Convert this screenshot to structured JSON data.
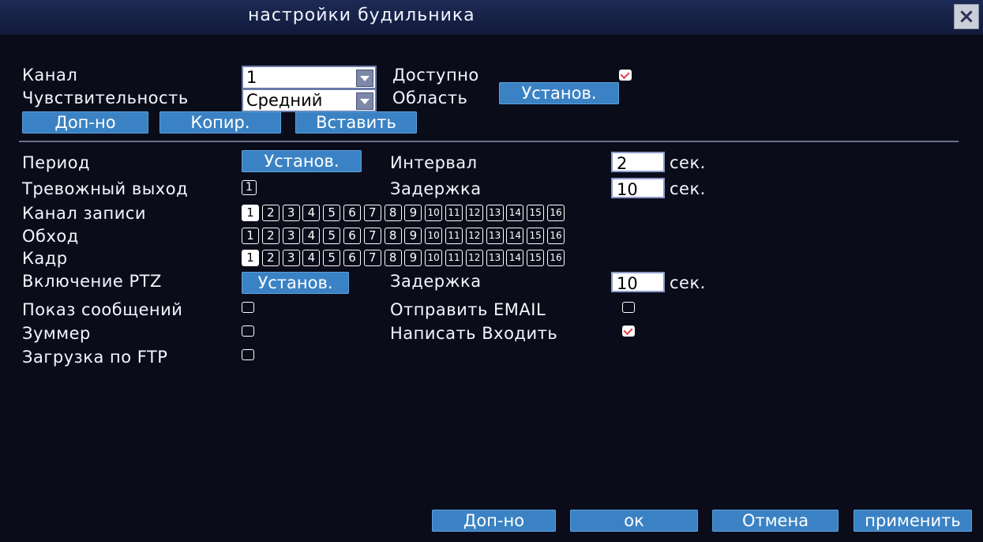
{
  "title": "настройки будильника",
  "close": "×",
  "top": {
    "channel_label": "Канал",
    "channel_value": "1",
    "enabled_label": "Доступно",
    "enabled_checked": true,
    "sensitivity_label": "Чувствительность",
    "sensitivity_value": "Средний",
    "area_label": "Область",
    "area_button": "Установ.",
    "extra_button": "Доп-но",
    "copy_button": "Копир.",
    "paste_button": "Вставить"
  },
  "settings": {
    "period_label": "Период",
    "period_button": "Установ.",
    "interval_label": "Интервал",
    "interval_value": "2",
    "interval_unit": "сек.",
    "alarm_out_label": "Тревожный выход",
    "alarm_out_box": "1",
    "delay_label": "Задержка",
    "delay_value": "10",
    "delay_unit": "сек.",
    "record_channel_label": "Канал записи",
    "tour_label": "Обход",
    "frame_label": "Кадр",
    "channels": [
      "1",
      "2",
      "3",
      "4",
      "5",
      "6",
      "7",
      "8",
      "9",
      "10",
      "11",
      "12",
      "13",
      "14",
      "15",
      "16"
    ],
    "record_selected": [
      1
    ],
    "tour_selected": [],
    "frame_selected": [
      1
    ],
    "ptz_label": "Включение PTZ",
    "ptz_button": "Установ.",
    "ptz_delay_label": "Задержка",
    "ptz_delay_value": "10",
    "ptz_delay_unit": "сек.",
    "show_msg_label": "Показ сообщений",
    "show_msg_checked": false,
    "send_email_label": "Отправить EMAIL",
    "send_email_checked": false,
    "buzzer_label": "Зуммер",
    "buzzer_checked": false,
    "write_log_label": "Написать Входить",
    "write_log_checked": true,
    "ftp_label": "Загрузка по FTP",
    "ftp_checked": false
  },
  "footer": {
    "extra_button": "Доп-но",
    "ok_button": "ок",
    "cancel_button": "Отмена",
    "apply_button": "применить"
  }
}
